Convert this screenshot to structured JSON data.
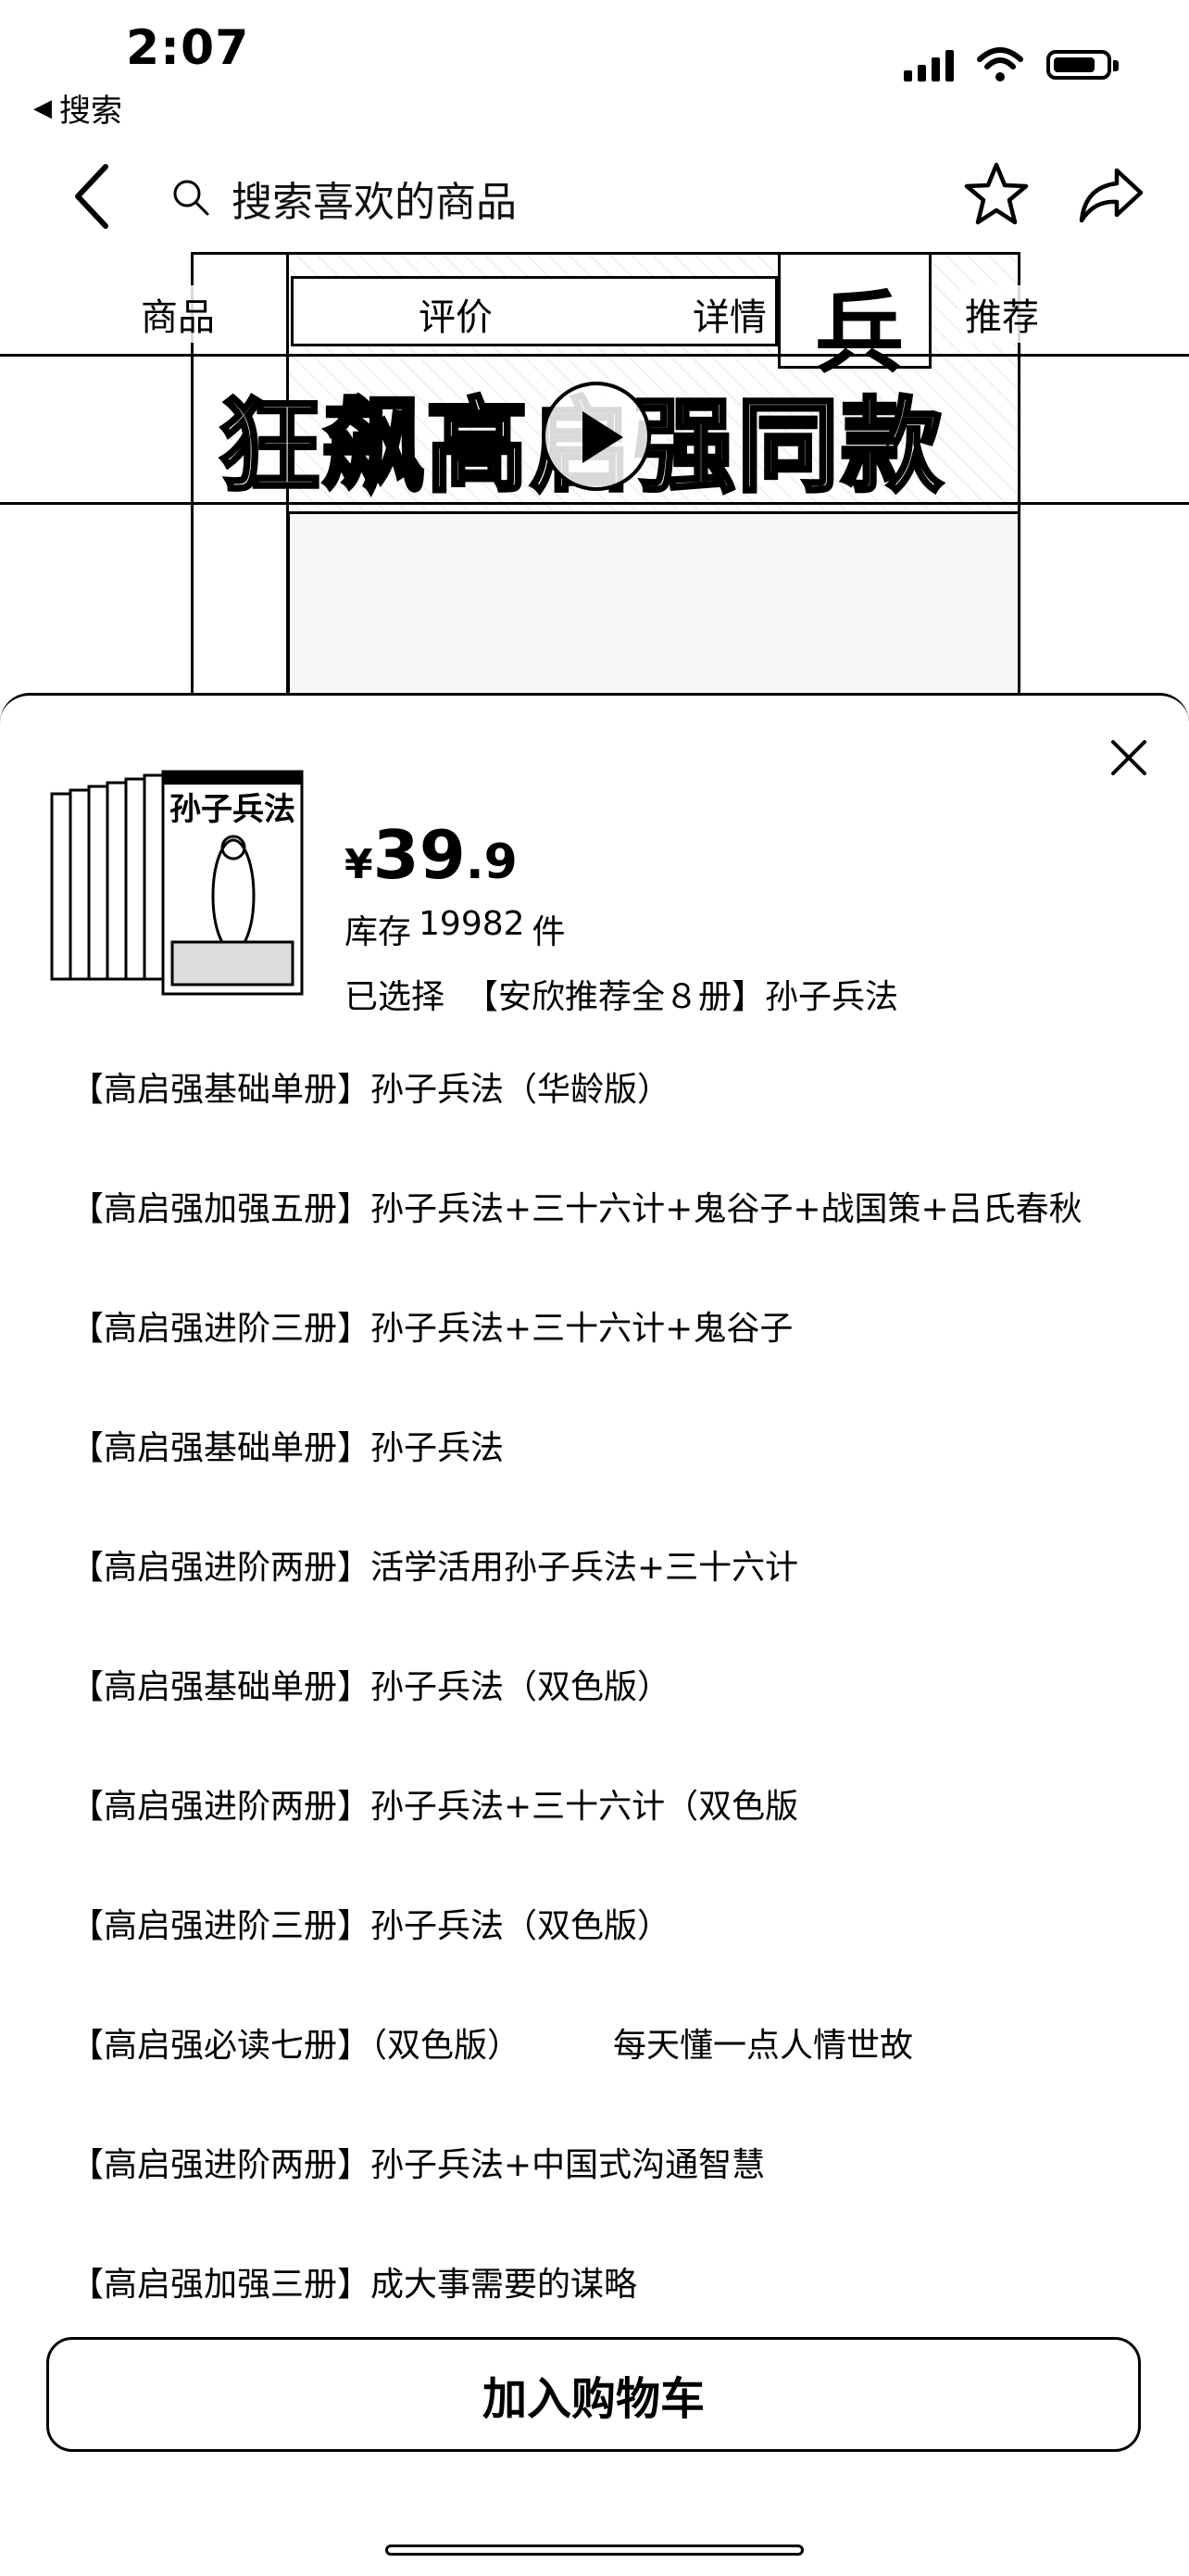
{
  "status_bar": {
    "time": "2:07",
    "back_app": "搜索"
  },
  "nav": {
    "search_placeholder": "搜索喜欢的商品"
  },
  "hero": {
    "tabs": [
      "商品",
      "评价",
      "详情",
      "推荐"
    ],
    "cover_char": "兵",
    "headline": "狂飙高启强同款"
  },
  "sheet": {
    "price": {
      "currency": "¥",
      "integer": "39",
      "decimal": ".9"
    },
    "stock": {
      "label": "库存",
      "count": "19982",
      "unit": "件"
    },
    "selected": {
      "label": "已选择",
      "value": "【安欣推荐全８册】孙子兵法"
    },
    "options": [
      {
        "tag": "【高启强基础单册】",
        "name": "孙子兵法（华龄版）"
      },
      {
        "tag": "【高启强加强五册】",
        "name": "孙子兵法+三十六计+鬼谷子+战国策+吕氏春秋"
      },
      {
        "tag": "【高启强进阶三册】",
        "name": "孙子兵法+三十六计+鬼谷子"
      },
      {
        "tag": "【高启强基础单册】",
        "name": "孙子兵法"
      },
      {
        "tag": "【高启强进阶两册】",
        "name": "活学活用孙子兵法+三十六计"
      },
      {
        "tag": "【高启强基础单册】",
        "name": "孙子兵法（双色版）"
      },
      {
        "tag": "【高启强进阶两册】",
        "name": "孙子兵法+三十六计（双色版"
      },
      {
        "tag": "【高启强进阶三册】",
        "name": "孙子兵法（双色版）"
      },
      {
        "tag": "【高启强必读七册】",
        "name": "（双色版）",
        "extra": "每天懂一点人情世故"
      },
      {
        "tag": "【高启强进阶两册】",
        "name": "孙子兵法+中国式沟通智慧"
      },
      {
        "tag": "【高启强加强三册】",
        "name": "成大事需要的谋略"
      }
    ],
    "add_to_cart": "加入购物车",
    "book_cover_title": "孙子兵法"
  },
  "icons": {
    "back": "chevron-left-icon",
    "search": "search-icon",
    "favorite": "star-icon",
    "share": "share-icon",
    "close": "close-icon",
    "play": "play-icon"
  }
}
